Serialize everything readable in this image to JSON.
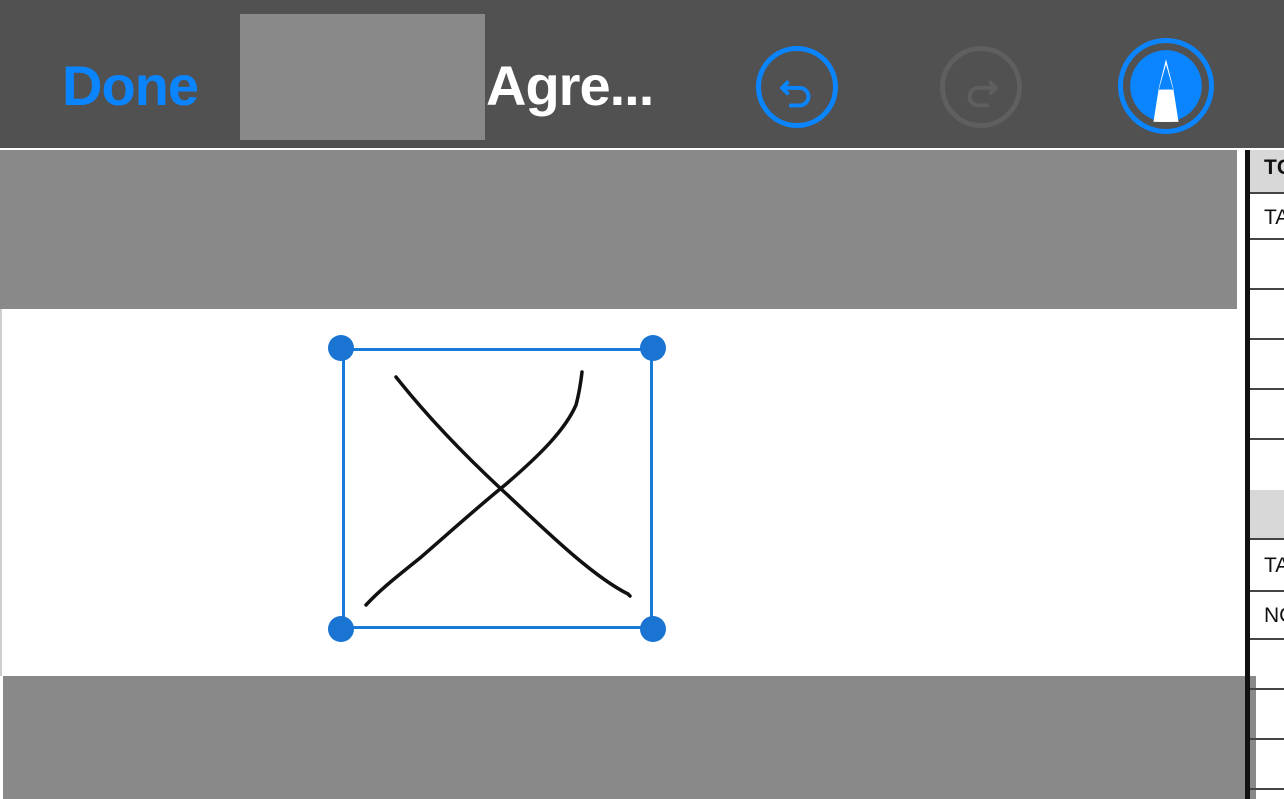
{
  "toolbar": {
    "done_label": "Done",
    "document_title": "Agre...",
    "undo_icon": "undo-icon",
    "redo_icon": "redo-icon",
    "markup_icon": "markup-pen-icon",
    "accent_color": "#0a84ff",
    "background_color": "#515151"
  },
  "side_table": {
    "header_text": "TC",
    "rows": [
      "TA",
      "",
      "",
      "",
      "",
      "",
      "TA",
      "NC",
      "",
      "",
      ""
    ]
  },
  "signature": {
    "shape": "X"
  },
  "redaction_color": "#898989"
}
